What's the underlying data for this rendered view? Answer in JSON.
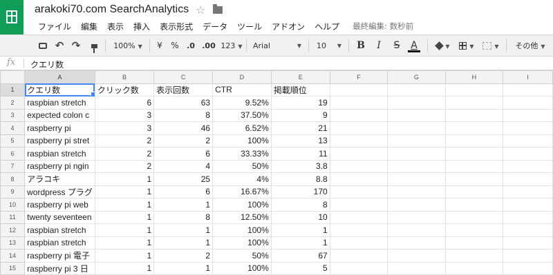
{
  "app": {
    "title": "arakoki70.com SearchAnalytics",
    "last_edit": "最終編集: 数秒前"
  },
  "menu": [
    "ファイル",
    "編集",
    "表示",
    "挿入",
    "表示形式",
    "データ",
    "ツール",
    "アドオン",
    "ヘルプ"
  ],
  "toolbar": {
    "zoom": "100%",
    "currency": "¥",
    "percent": "%",
    "dec_decrease": ".0",
    "dec_increase": ".00",
    "more_formats": "123",
    "font": "Arial",
    "font_size": "10",
    "bold": "B",
    "italic": "I",
    "strike": "S",
    "text_color": "A",
    "more": "その他"
  },
  "formula_bar": {
    "fx": "fx",
    "value": "クエリ数"
  },
  "columns": [
    "A",
    "B",
    "C",
    "D",
    "E",
    "F",
    "G",
    "H",
    "I"
  ],
  "rows": [
    {
      "n": "1",
      "a": "クエリ数",
      "b": "クリック数",
      "c": "表示回数",
      "d": "CTR",
      "e": "掲載順位"
    },
    {
      "n": "2",
      "a": "raspbian stretch",
      "b": "6",
      "c": "63",
      "d": "9.52%",
      "e": "19"
    },
    {
      "n": "3",
      "a": "expected colon c",
      "b": "3",
      "c": "8",
      "d": "37.50%",
      "e": "9"
    },
    {
      "n": "4",
      "a": "raspberry pi",
      "b": "3",
      "c": "46",
      "d": "6.52%",
      "e": "21"
    },
    {
      "n": "5",
      "a": "raspberry pi stret",
      "b": "2",
      "c": "2",
      "d": "100%",
      "e": "13"
    },
    {
      "n": "6",
      "a": "raspbian stretch",
      "b": "2",
      "c": "6",
      "d": "33.33%",
      "e": "11"
    },
    {
      "n": "7",
      "a": "raspberry pi ngin",
      "b": "2",
      "c": "4",
      "d": "50%",
      "e": "3.8"
    },
    {
      "n": "8",
      "a": "アラコキ",
      "b": "1",
      "c": "25",
      "d": "4%",
      "e": "8.8"
    },
    {
      "n": "9",
      "a": "wordpress プラグ",
      "b": "1",
      "c": "6",
      "d": "16.67%",
      "e": "170"
    },
    {
      "n": "10",
      "a": "raspberry pi web",
      "b": "1",
      "c": "1",
      "d": "100%",
      "e": "8"
    },
    {
      "n": "11",
      "a": "twenty seventeen",
      "b": "1",
      "c": "8",
      "d": "12.50%",
      "e": "10"
    },
    {
      "n": "12",
      "a": "raspbian stretch",
      "b": "1",
      "c": "1",
      "d": "100%",
      "e": "1"
    },
    {
      "n": "13",
      "a": "raspbian stretch",
      "b": "1",
      "c": "1",
      "d": "100%",
      "e": "1"
    },
    {
      "n": "14",
      "a": "raspberry pi 電子",
      "b": "1",
      "c": "2",
      "d": "50%",
      "e": "67"
    },
    {
      "n": "15",
      "a": "raspberry pi 3 日",
      "b": "1",
      "c": "1",
      "d": "100%",
      "e": "5"
    }
  ],
  "colors": {
    "brand": "#0f9d58",
    "selection": "#4285f4"
  }
}
